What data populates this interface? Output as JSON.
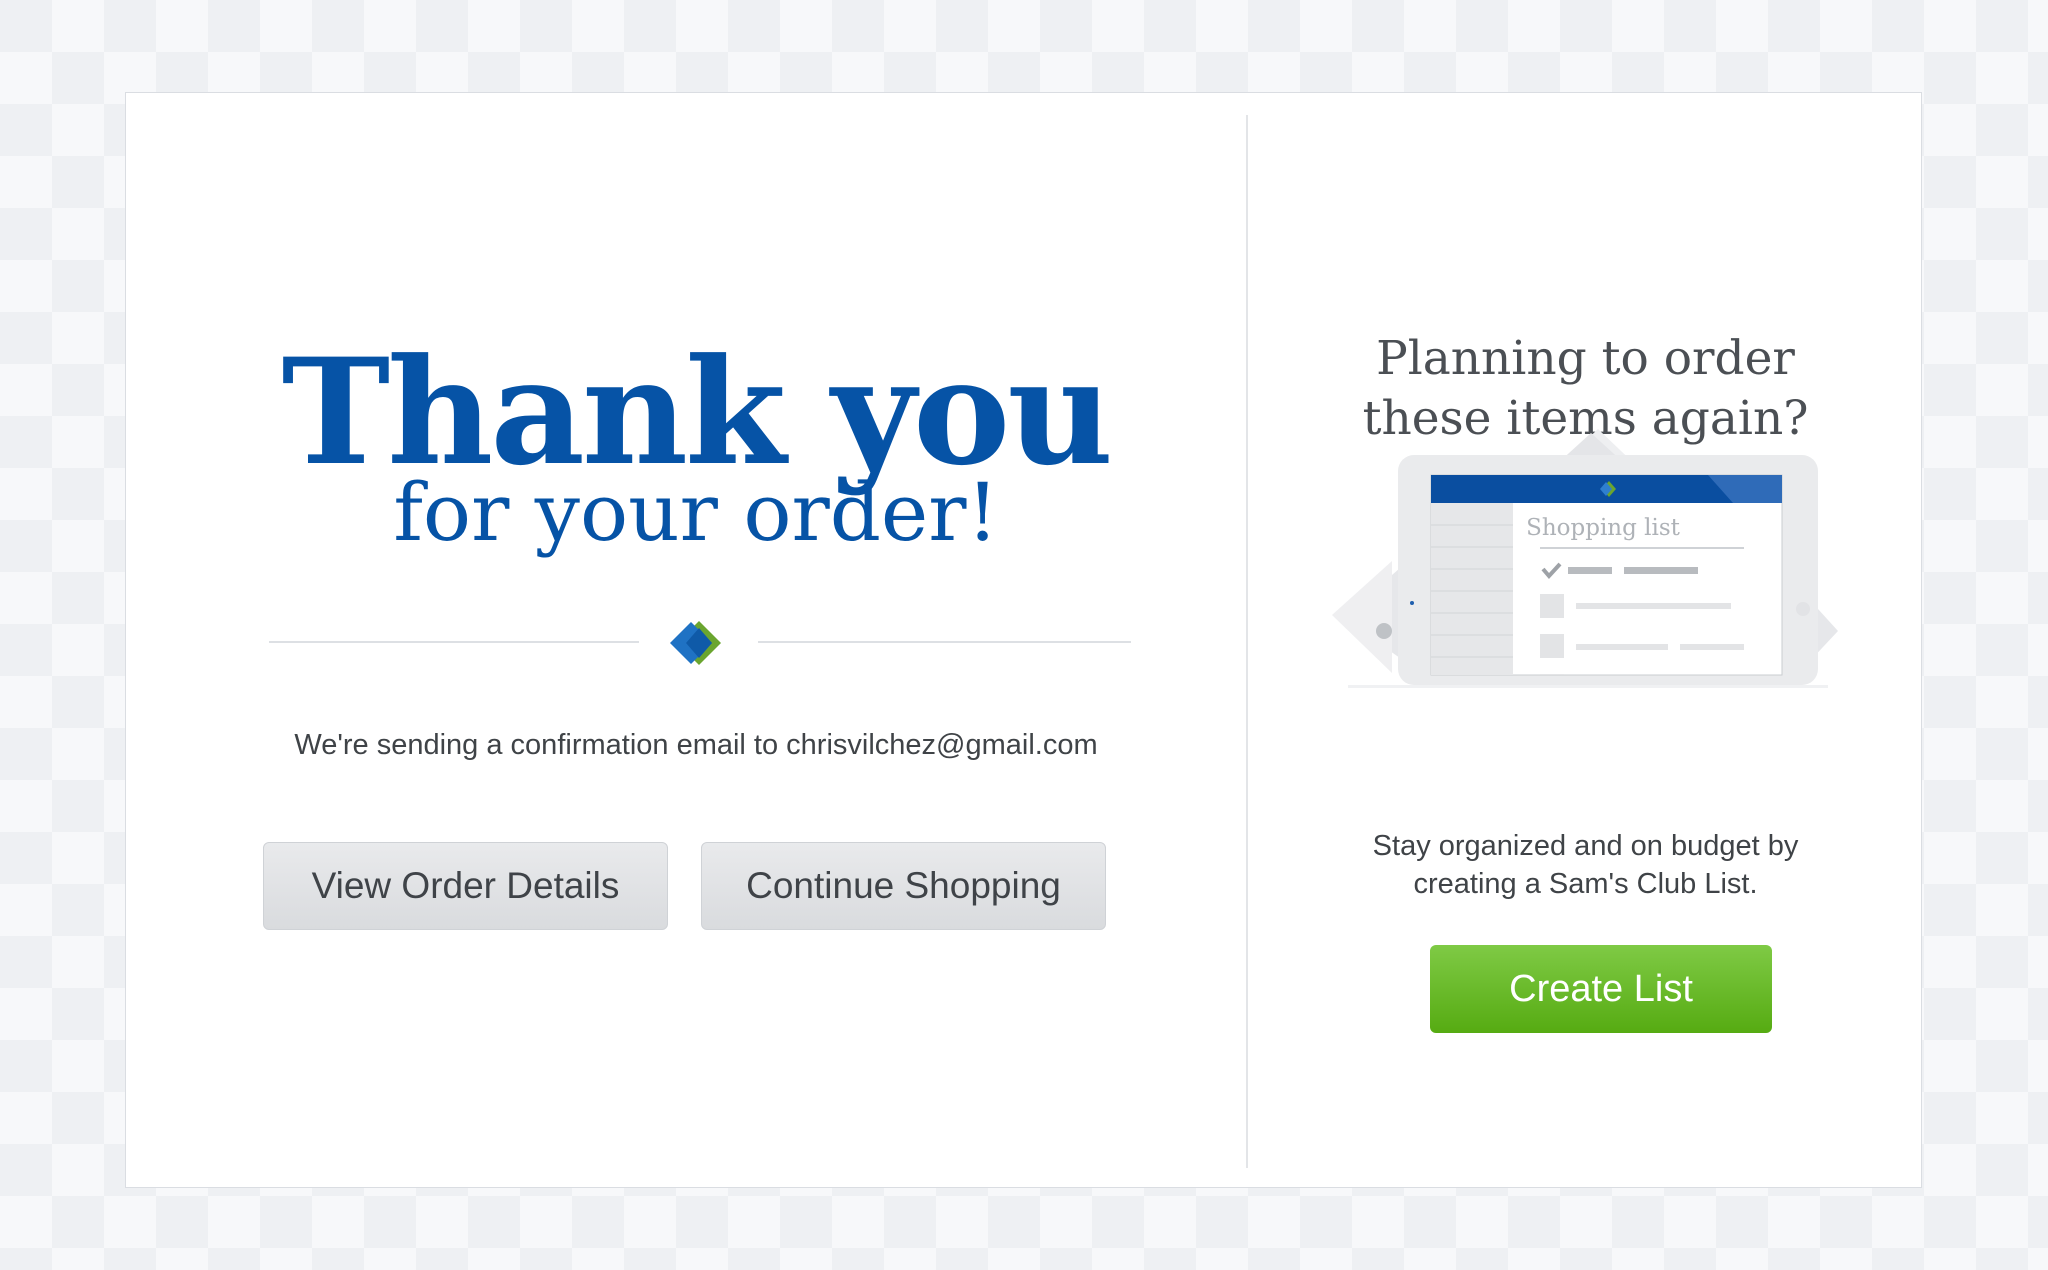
{
  "confirmation": {
    "title": "Thank you",
    "subtitle": "for your order!",
    "email_message": "We're sending a confirmation email to chrisvilchez@gmail.com",
    "view_order_label": "View Order Details",
    "continue_shopping_label": "Continue Shopping"
  },
  "promo": {
    "heading_line1": "Planning to order",
    "heading_line2": "these items again?",
    "illustration_label": "Shopping list",
    "description_line1": "Stay organized and on budget by",
    "description_line2": "creating a Sam's Club List.",
    "create_list_label": "Create List"
  },
  "colors": {
    "brand_blue": "#0653a6",
    "create_green": "#56ab12",
    "logo_green": "#6aa52f"
  }
}
